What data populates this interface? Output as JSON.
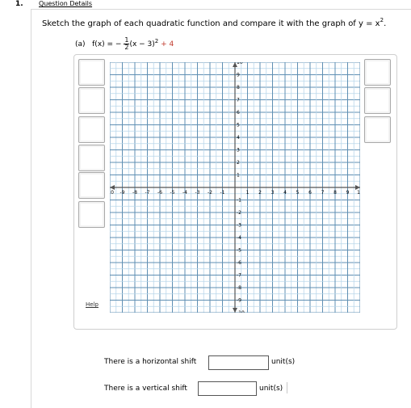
{
  "question": {
    "number": "1.",
    "details_label": "Question Details",
    "instruction_text": "Sketch the graph of each quadratic function and compare it with the graph of y = x",
    "instruction_exp": "2",
    "instruction_end": "."
  },
  "part": {
    "label": "(a)",
    "fx": "f(x) = −",
    "frac_num": "1",
    "frac_den": "2",
    "expr_mid": "(x − 3)",
    "expr_exp": "2",
    "expr_plus": " + 4"
  },
  "tools": {
    "left": [
      "tool-1",
      "tool-2",
      "tool-3",
      "tool-4",
      "tool-5",
      "tool-6"
    ],
    "right": [
      "tool-r1",
      "tool-r2",
      "tool-r3"
    ]
  },
  "help_label": "Help",
  "grid": {
    "xmin": -10,
    "xmax": 10,
    "ymin": -10,
    "ymax": 10,
    "x_ticks": [
      "-10",
      "-9",
      "-8",
      "-7",
      "-6",
      "-5",
      "-4",
      "-3",
      "-2",
      "-1",
      "1",
      "2",
      "3",
      "4",
      "5",
      "6",
      "7",
      "8",
      "9",
      "10"
    ],
    "y_ticks": [
      "10",
      "9",
      "8",
      "7",
      "6",
      "5",
      "4",
      "3",
      "2",
      "1",
      "-1",
      "-2",
      "-3",
      "-4",
      "-5",
      "-6",
      "-7",
      "-8",
      "-9",
      "-10"
    ],
    "minor_color": "#b9d6ea",
    "major_color": "#5f8fb3",
    "axis_color": "#555555"
  },
  "answers": {
    "horizontal_label": "There is a horizontal shift",
    "horizontal_value": "",
    "horizontal_unit": "unit(s)",
    "vertical_label": "There is a vertical shift",
    "vertical_value": "",
    "vertical_unit": "unit(s)"
  }
}
